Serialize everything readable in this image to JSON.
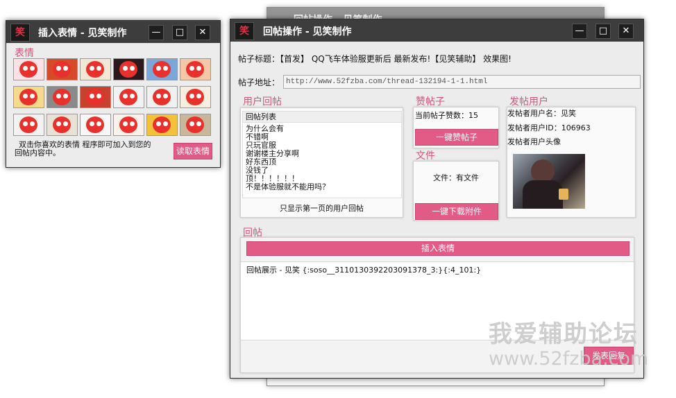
{
  "watermark": {
    "line1": "我爱辅助论坛",
    "line2": "www.52fzba.com"
  },
  "back_window": {
    "title": "回帖操作 - 见笑制作"
  },
  "emoji_window": {
    "title": "插入表情 - 见笑制作",
    "label": "表情",
    "hint_line1": "双击你喜欢的表情 程序即可加入到您的",
    "hint_line2": "回帖内容中。",
    "read_button": "读取表情",
    "emojis": [
      {
        "bg": "#fbe2e4"
      },
      {
        "bg": "#d64a2a"
      },
      {
        "bg": "#f3e8d6"
      },
      {
        "bg": "#2a1a1e"
      },
      {
        "bg": "#7aa6d8"
      },
      {
        "bg": "#f4c8a6"
      },
      {
        "bg": "#f5d98c"
      },
      {
        "bg": "#8a8a8a"
      },
      {
        "bg": "#c8402e"
      },
      {
        "bg": "#f2f2f2"
      },
      {
        "bg": "#f0f0f0"
      },
      {
        "bg": "#f6efe0"
      },
      {
        "bg": "#f2f2f2"
      },
      {
        "bg": "#e8e2d6"
      },
      {
        "bg": "#f7f7f7"
      },
      {
        "bg": "#f9f1ea"
      },
      {
        "bg": "#f2c23a"
      },
      {
        "bg": "#c9b79c"
      }
    ]
  },
  "main_window": {
    "title": "回帖操作 - 见笑制作",
    "thread_title_label": "帖子标题：",
    "thread_title_value": "【首发】 QQ飞车体验服更新后 最新发布!【见笑辅助】 效果图!",
    "url_label": "帖子地址：",
    "url_value": "http://www.52fzba.com/thread-132194-1-1.html",
    "user_replies": {
      "label": "用户回帖",
      "list_header": "回帖列表",
      "items": [
        "为什么会有",
        "不错啊",
        "只玩官服",
        "谢谢楼主分享啊",
        "好东西顶",
        "没钱了",
        "顶！！！！！！",
        "不是体验服就不能用吗？"
      ],
      "footer": "只显示第一页的用户回帖"
    },
    "like": {
      "label": "赞帖子",
      "count_text": "当前帖子赞数：15",
      "button": "一键赞帖子"
    },
    "file": {
      "label": "文件",
      "status": "文件：有文件",
      "button": "一键下载附件"
    },
    "poster": {
      "label": "发帖用户",
      "name": "发帖者用户名：见笑",
      "id": "发帖者用户ID：106963",
      "avatar_label": "发帖者用户头像"
    },
    "reply": {
      "label": "回帖",
      "insert_button": "插入表情",
      "content": "回帖展示 - 见笑 {:soso__3110130392203091378_3:}{:4_101:}",
      "send_button": "发表回复"
    }
  }
}
